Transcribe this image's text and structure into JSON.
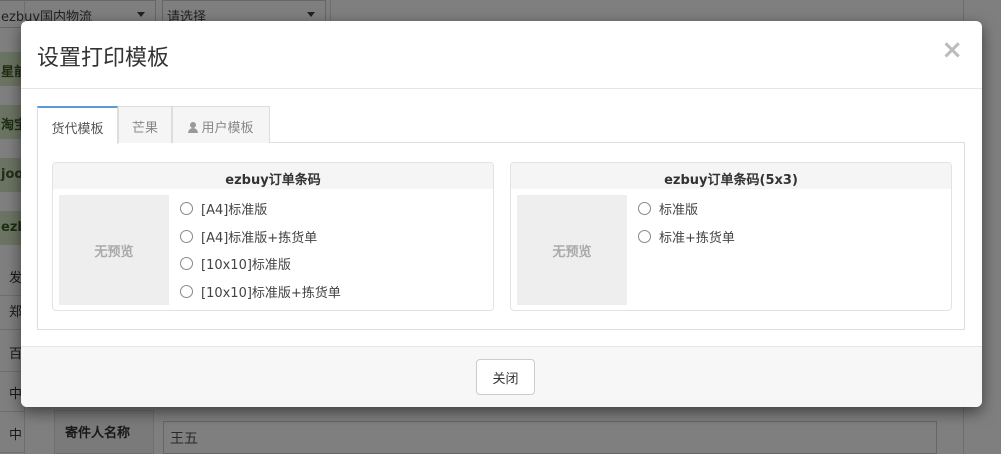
{
  "background": {
    "select_1": "ezbuy国内物流",
    "select_2": "请选择",
    "green_rows": [
      "星前",
      "淘宝",
      "joo",
      "ezb"
    ],
    "side_cells": [
      "发",
      "郑",
      "百",
      "中",
      "中"
    ],
    "sender_label": "寄件人名称",
    "sender_value": "王五"
  },
  "modal": {
    "title": "设置打印模板",
    "close_symbol": "×",
    "tabs": [
      {
        "label": "货代模板",
        "active": true
      },
      {
        "label": "芒果",
        "active": false
      },
      {
        "label": "用户模板",
        "active": false,
        "icon": "user-icon"
      }
    ],
    "cards": [
      {
        "title": "ezbuy订单条码",
        "preview": "无预览",
        "options": [
          "[A4]标准版",
          "[A4]标准版+拣货单",
          "[10x10]标准版",
          "[10x10]标准版+拣货单"
        ]
      },
      {
        "title": "ezbuy订单条码(5x3)",
        "preview": "无预览",
        "options": [
          "标准版",
          "标准+拣货单"
        ]
      }
    ],
    "footer": {
      "close_label": "关闭"
    }
  }
}
